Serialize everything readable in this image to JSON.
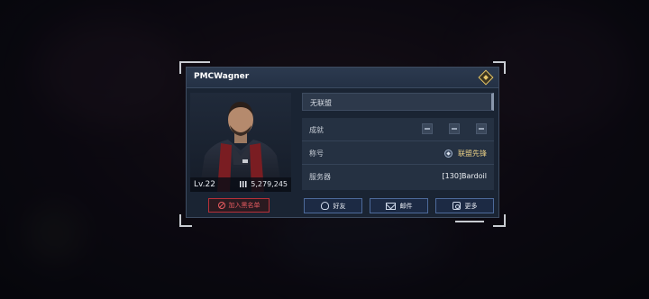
{
  "profile": {
    "player_name": "PMCWagner",
    "level": "Lv.22",
    "power": "5,279,245",
    "alliance": "无联盟"
  },
  "info": {
    "achievements_label": "成就",
    "title_label": "称号",
    "title_value": "联盟先锋",
    "server_label": "服务器",
    "server_value": "[130]Bardoil"
  },
  "actions": {
    "blacklist": "加入黑名单",
    "friend": "好友",
    "mail": "邮件",
    "more": "更多"
  },
  "colors": {
    "accent": "#4d6a9a",
    "danger": "#e45a5f",
    "gold": "#e9cf86"
  },
  "icons": [
    "ban-icon",
    "friend-icon",
    "mail-icon",
    "more-icon",
    "title-badge-icon",
    "power-icon",
    "diamond-icon"
  ]
}
